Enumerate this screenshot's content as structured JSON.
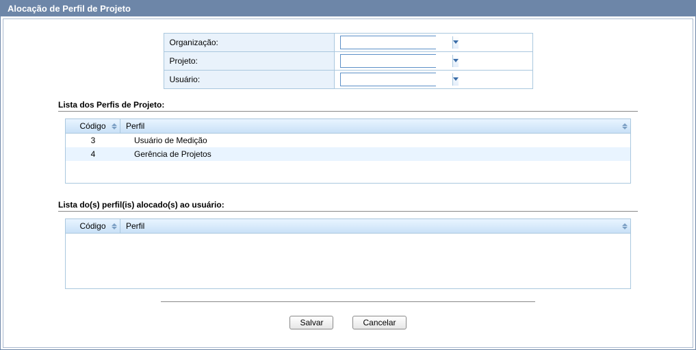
{
  "window": {
    "title": "Alocação de Perfil de Projeto"
  },
  "form": {
    "organizacao": {
      "label": "Organização:",
      "value": ""
    },
    "projeto": {
      "label": "Projeto:",
      "value": ""
    },
    "usuario": {
      "label": "Usuário:",
      "value": ""
    }
  },
  "sections": {
    "available": {
      "title": "Lista dos Perfis de Projeto:",
      "columns": {
        "codigo": "Código",
        "perfil": "Perfil"
      },
      "rows": [
        {
          "codigo": "3",
          "perfil": "Usuário de Medição"
        },
        {
          "codigo": "4",
          "perfil": "Gerência de Projetos"
        }
      ]
    },
    "assigned": {
      "title": "Lista do(s) perfil(is) alocado(s) ao usuário:",
      "columns": {
        "codigo": "Código",
        "perfil": "Perfil"
      },
      "rows": []
    }
  },
  "buttons": {
    "save": "Salvar",
    "cancel": "Cancelar"
  }
}
